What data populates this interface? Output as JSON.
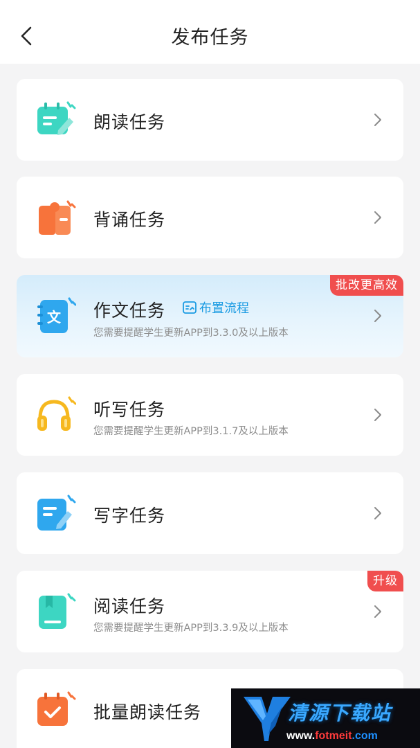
{
  "header": {
    "title": "发布任务"
  },
  "tasks": [
    {
      "label": "朗读任务",
      "icon": "calendar-pencil-icon"
    },
    {
      "label": "背诵任务",
      "icon": "open-book-icon"
    },
    {
      "label": "作文任务",
      "sub": "您需要提醒学生更新APP到3.3.0及以上版本",
      "badge": "批改更高效",
      "flow_label": "布置流程",
      "icon": "essay-notebook-icon"
    },
    {
      "label": "听写任务",
      "sub": "您需要提醒学生更新APP到3.1.7及以上版本",
      "icon": "headphones-icon"
    },
    {
      "label": "写字任务",
      "icon": "notepad-pencil-icon"
    },
    {
      "label": "阅读任务",
      "sub": "您需要提醒学生更新APP到3.3.9及以上版本",
      "badge": "升级",
      "icon": "bookmark-book-icon"
    },
    {
      "label": "批量朗读任务",
      "icon": "calendar-check-icon"
    }
  ],
  "watermark": {
    "name": "清源下载站",
    "url_part1": "www.",
    "url_part2": "fotmeit",
    "url_part3": ".com"
  },
  "colors": {
    "teal": "#3dd6c2",
    "orange": "#f7733b",
    "blue": "#2fa7ee",
    "yellow": "#f6b81f",
    "badge_red": "#f04e4e"
  }
}
